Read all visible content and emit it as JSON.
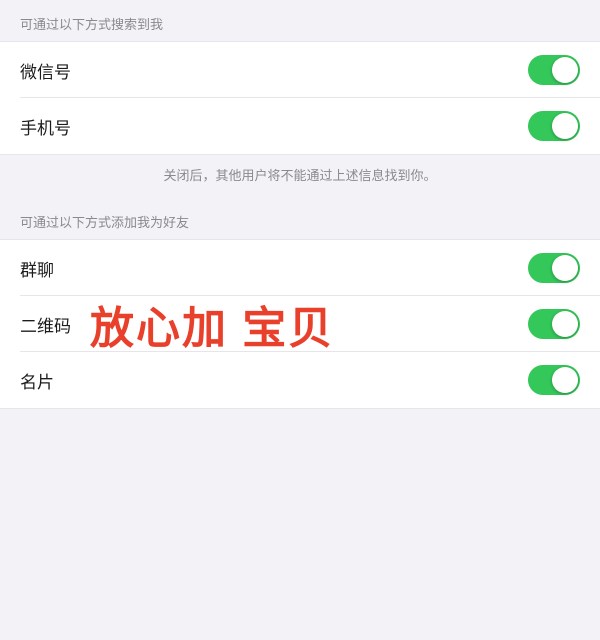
{
  "sections": [
    {
      "id": "search-section",
      "header": "可通过以下方式搜索到我",
      "rows": [
        {
          "id": "wechat-id",
          "label": "微信号",
          "enabled": true
        },
        {
          "id": "phone-number",
          "label": "手机号",
          "enabled": true
        }
      ],
      "note": "关闭后，其他用户将不能通过上述信息找到你。"
    },
    {
      "id": "add-friend-section",
      "header": "可通过以下方式添加我为好友",
      "rows": [
        {
          "id": "group-chat",
          "label": "群聊",
          "enabled": true
        },
        {
          "id": "qr-code",
          "label": "二维码",
          "enabled": true,
          "overlay": "放心加 宝贝"
        },
        {
          "id": "business-card",
          "label": "名片",
          "enabled": true
        }
      ]
    }
  ]
}
